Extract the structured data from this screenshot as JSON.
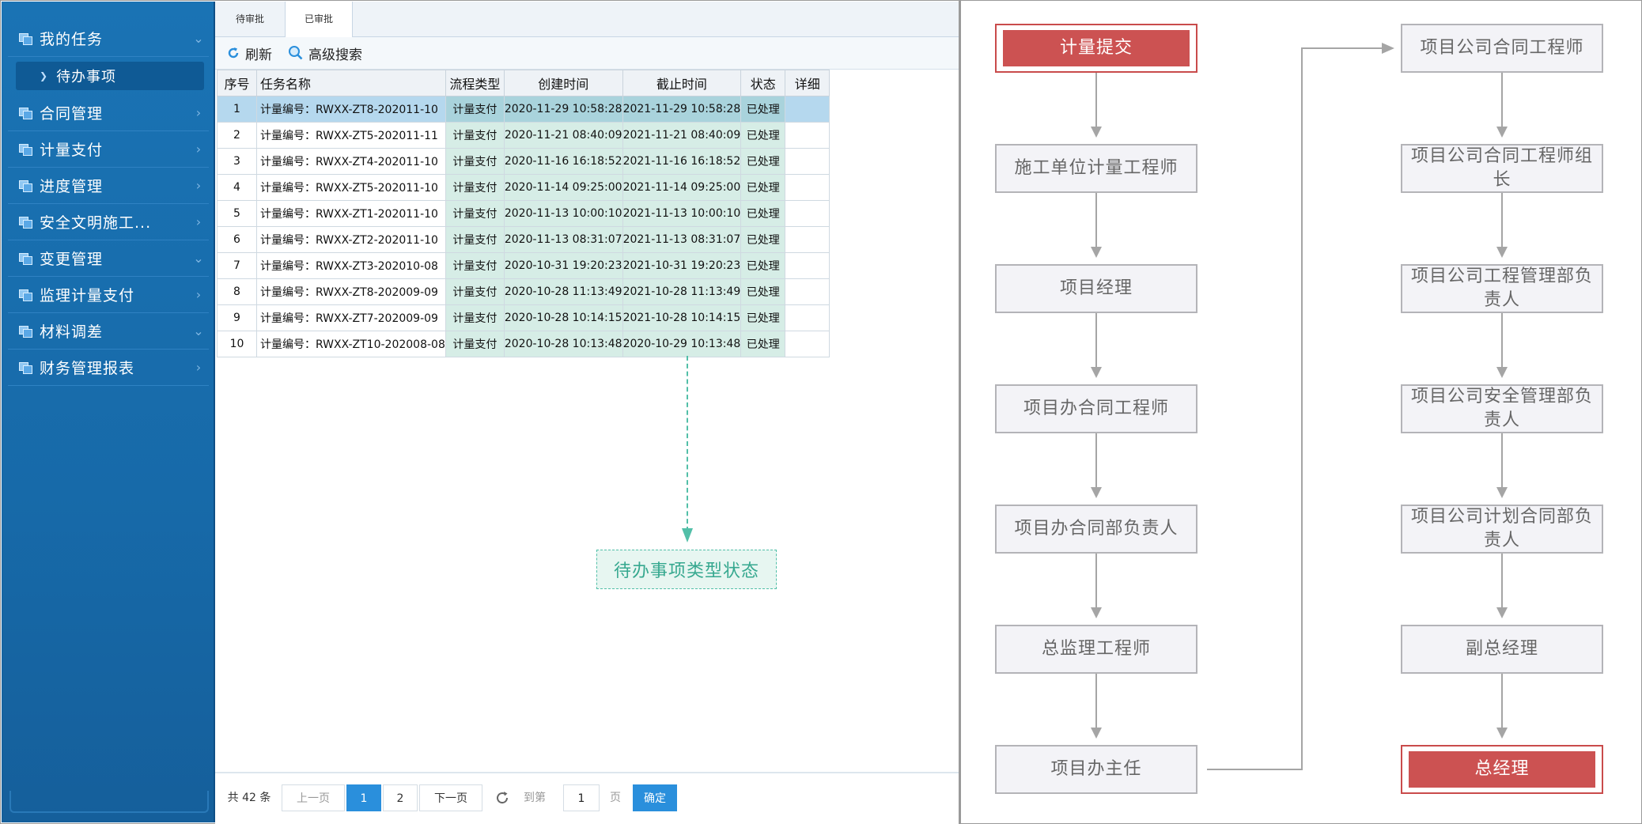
{
  "sidebar": {
    "items": [
      {
        "label": "我的任务",
        "arrow": "expanded"
      },
      {
        "label": "合同管理",
        "arrow": "collapsed"
      },
      {
        "label": "计量支付",
        "arrow": "collapsed"
      },
      {
        "label": "进度管理",
        "arrow": "collapsed"
      },
      {
        "label": "安全文明施工...",
        "arrow": "collapsed"
      },
      {
        "label": "变更管理",
        "arrow": "expanded"
      },
      {
        "label": "监理计量支付",
        "arrow": "collapsed"
      },
      {
        "label": "材料调差",
        "arrow": "expanded"
      },
      {
        "label": "财务管理报表",
        "arrow": "collapsed"
      }
    ],
    "submenu": "待办事项"
  },
  "tabs": [
    {
      "label": "待审批"
    },
    {
      "label": "已审批"
    }
  ],
  "toolbar": {
    "refresh": "刷新",
    "search": "高级搜索"
  },
  "table": {
    "headers": [
      "序号",
      "任务名称",
      "流程类型",
      "创建时间",
      "截止时间",
      "状态",
      "详细"
    ],
    "rows": [
      {
        "no": "1",
        "name": "计量编号：RWXX-ZT8-202011-10",
        "type": "计量支付",
        "created": "2020-11-29 10:58:28",
        "deadline": "2021-11-29 10:58:28",
        "status": "已处理"
      },
      {
        "no": "2",
        "name": "计量编号：RWXX-ZT5-202011-11",
        "type": "计量支付",
        "created": "2020-11-21 08:40:09",
        "deadline": "2021-11-21 08:40:09",
        "status": "已处理"
      },
      {
        "no": "3",
        "name": "计量编号：RWXX-ZT4-202011-10",
        "type": "计量支付",
        "created": "2020-11-16 16:18:52",
        "deadline": "2021-11-16 16:18:52",
        "status": "已处理"
      },
      {
        "no": "4",
        "name": "计量编号：RWXX-ZT5-202011-10",
        "type": "计量支付",
        "created": "2020-11-14 09:25:00",
        "deadline": "2021-11-14 09:25:00",
        "status": "已处理"
      },
      {
        "no": "5",
        "name": "计量编号：RWXX-ZT1-202011-10",
        "type": "计量支付",
        "created": "2020-11-13 10:00:10",
        "deadline": "2021-11-13 10:00:10",
        "status": "已处理"
      },
      {
        "no": "6",
        "name": "计量编号：RWXX-ZT2-202011-10",
        "type": "计量支付",
        "created": "2020-11-13 08:31:07",
        "deadline": "2021-11-13 08:31:07",
        "status": "已处理"
      },
      {
        "no": "7",
        "name": "计量编号：RWXX-ZT3-202010-08",
        "type": "计量支付",
        "created": "2020-10-31 19:20:23",
        "deadline": "2021-10-31 19:20:23",
        "status": "已处理"
      },
      {
        "no": "8",
        "name": "计量编号：RWXX-ZT8-202009-09",
        "type": "计量支付",
        "created": "2020-10-28 11:13:49",
        "deadline": "2021-10-28 11:13:49",
        "status": "已处理"
      },
      {
        "no": "9",
        "name": "计量编号：RWXX-ZT7-202009-09",
        "type": "计量支付",
        "created": "2020-10-28 10:14:15",
        "deadline": "2021-10-28 10:14:15",
        "status": "已处理"
      },
      {
        "no": "10",
        "name": "计量编号：RWXX-ZT10-202008-08",
        "type": "计量支付",
        "created": "2020-10-28 10:13:48",
        "deadline": "2020-10-29 10:13:48",
        "status": "已处理"
      }
    ]
  },
  "annotation": "待办事项类型状态",
  "pager": {
    "total": "共 42 条",
    "prev": "上一页",
    "pages": [
      "1",
      "2"
    ],
    "next": "下一页",
    "goto": "到第",
    "page_value": "1",
    "page_unit": "页",
    "confirm": "确定"
  },
  "flow": {
    "left": [
      "计量提交",
      "施工单位计量工程师",
      "项目经理",
      "项目办合同工程师",
      "项目办合同部负责人",
      "总监理工程师",
      "项目办主任"
    ],
    "right": [
      "项目公司合同工程师",
      "项目公司合同工程师组长",
      "项目公司工程管理部负责人",
      "项目公司安全管理部负责人",
      "项目公司计划合同部负责人",
      "副总经理",
      "总经理"
    ]
  },
  "colors": {
    "sidebar": "#1a73b4",
    "accent": "#2a8fdc",
    "highlight_node": "#cc5252",
    "annotation": "#52bfa8"
  }
}
